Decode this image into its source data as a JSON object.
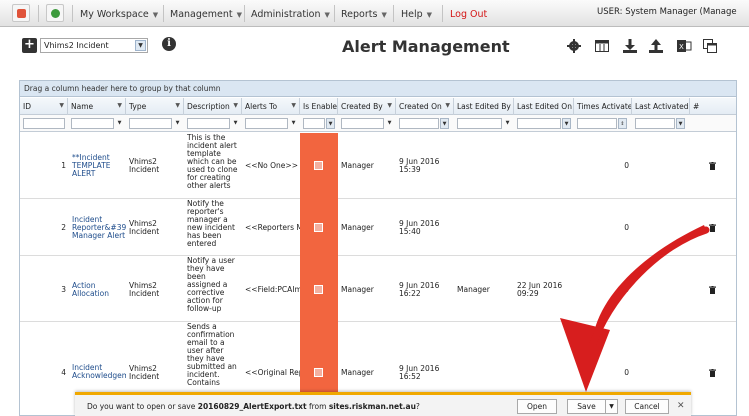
{
  "nav": {
    "items": [
      {
        "label": "My Workspace"
      },
      {
        "label": "Management"
      },
      {
        "label": "Administration"
      },
      {
        "label": "Reports"
      },
      {
        "label": "Help"
      }
    ],
    "logout": "Log Out",
    "user": "USER: System Manager (Manage"
  },
  "toolbar": {
    "template_select": "Vhims2 Incident",
    "title": "Alert Management",
    "icons": [
      "gear-icon",
      "columns-icon",
      "download-icon",
      "upload-icon",
      "excel-icon",
      "clone-icon"
    ]
  },
  "grid": {
    "group_hint": "Drag a column header here to group by that column",
    "columns": [
      "ID",
      "Name",
      "Type",
      "Description",
      "Alerts To",
      "Is Enable",
      "Created By",
      "Created On",
      "Last Edited By",
      "Last Edited On",
      "Times Activated",
      "Last Activated C",
      "#"
    ],
    "rows": [
      {
        "id": "1",
        "name": "**Incident TEMPLATE ALERT",
        "type": "Vhims2 Incident",
        "description": "This is the incident alert template which can be used to clone for creating other alerts",
        "alerts_to": "<<No One>>",
        "created_by": "Manager",
        "created_on": "9 Jun 2016 15:39",
        "last_edited_by": "",
        "last_edited_on": "",
        "times_activated": "0"
      },
      {
        "id": "2",
        "name": "Incident Reporter&#39; Manager Alert",
        "type": "Vhims2 Incident",
        "description": "Notify the reporter's manager a new incident has been entered",
        "alerts_to": "<<Reporters M",
        "created_by": "Manager",
        "created_on": "9 Jun 2016 15:40",
        "last_edited_by": "",
        "last_edited_on": "",
        "times_activated": "0"
      },
      {
        "id": "3",
        "name": "Action Allocation",
        "type": "Vhims2 Incident",
        "description": "Notify a user they have been assigned a corrective action for follow-up",
        "alerts_to": "<<Field:PCAIm",
        "created_by": "Manager",
        "created_on": "9 Jun 2016 16:22",
        "last_edited_by": "Manager",
        "last_edited_on": "22 Jun 2016 09:29",
        "times_activated": "0"
      },
      {
        "id": "4",
        "name": "Incident Acknowledgem",
        "type": "Vhims2 Incident",
        "description": "Sends a confirmation email to a user after they have submitted an incident. Contains",
        "alerts_to": "<<Original Rep",
        "created_by": "Manager",
        "created_on": "9 Jun 2016 16:52",
        "last_edited_by": "",
        "last_edited_on": "",
        "times_activated": "0"
      }
    ]
  },
  "download_bar": {
    "message_prefix": "Do you want to open or save ",
    "filename": "20160829_AlertExport.txt",
    "message_middle": " from ",
    "site": "sites.riskman.net.au",
    "message_suffix": "?",
    "open": "Open",
    "save": "Save",
    "cancel": "Cancel"
  },
  "colors": {
    "enabled_column": "#f2653f",
    "annotation_arrow": "#d71e1e",
    "logout": "#d41515"
  }
}
